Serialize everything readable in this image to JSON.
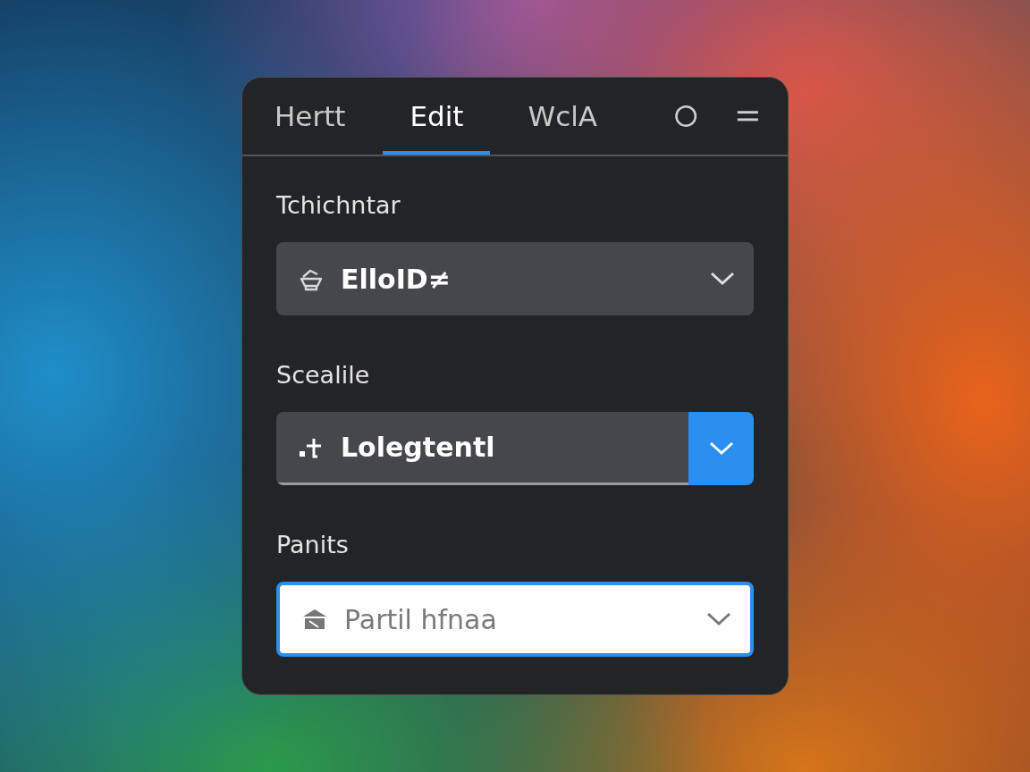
{
  "tabs": [
    {
      "label": "Hertt",
      "selected": false
    },
    {
      "label": "Edit",
      "selected": true
    },
    {
      "label": "WclA",
      "selected": false
    }
  ],
  "fields": [
    {
      "kind": "dropdown",
      "label": "Tchichntar",
      "value": "ElloID≠"
    },
    {
      "kind": "split",
      "label": "Scealile",
      "value": "Lolegtentl"
    },
    {
      "kind": "focused",
      "label": "Panits",
      "placeholder": "Partil hfnaa"
    }
  ]
}
